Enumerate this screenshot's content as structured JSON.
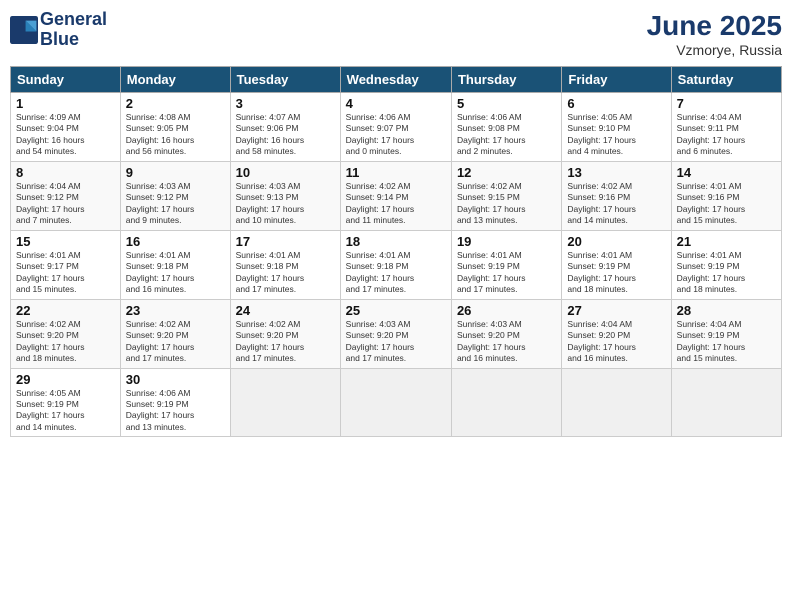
{
  "logo": {
    "line1": "General",
    "line2": "Blue"
  },
  "title": "June 2025",
  "location": "Vzmorye, Russia",
  "days_header": [
    "Sunday",
    "Monday",
    "Tuesday",
    "Wednesday",
    "Thursday",
    "Friday",
    "Saturday"
  ],
  "weeks": [
    [
      {
        "num": "1",
        "info": "Sunrise: 4:09 AM\nSunset: 9:04 PM\nDaylight: 16 hours\nand 54 minutes."
      },
      {
        "num": "2",
        "info": "Sunrise: 4:08 AM\nSunset: 9:05 PM\nDaylight: 16 hours\nand 56 minutes."
      },
      {
        "num": "3",
        "info": "Sunrise: 4:07 AM\nSunset: 9:06 PM\nDaylight: 16 hours\nand 58 minutes."
      },
      {
        "num": "4",
        "info": "Sunrise: 4:06 AM\nSunset: 9:07 PM\nDaylight: 17 hours\nand 0 minutes."
      },
      {
        "num": "5",
        "info": "Sunrise: 4:06 AM\nSunset: 9:08 PM\nDaylight: 17 hours\nand 2 minutes."
      },
      {
        "num": "6",
        "info": "Sunrise: 4:05 AM\nSunset: 9:10 PM\nDaylight: 17 hours\nand 4 minutes."
      },
      {
        "num": "7",
        "info": "Sunrise: 4:04 AM\nSunset: 9:11 PM\nDaylight: 17 hours\nand 6 minutes."
      }
    ],
    [
      {
        "num": "8",
        "info": "Sunrise: 4:04 AM\nSunset: 9:12 PM\nDaylight: 17 hours\nand 7 minutes."
      },
      {
        "num": "9",
        "info": "Sunrise: 4:03 AM\nSunset: 9:12 PM\nDaylight: 17 hours\nand 9 minutes."
      },
      {
        "num": "10",
        "info": "Sunrise: 4:03 AM\nSunset: 9:13 PM\nDaylight: 17 hours\nand 10 minutes."
      },
      {
        "num": "11",
        "info": "Sunrise: 4:02 AM\nSunset: 9:14 PM\nDaylight: 17 hours\nand 11 minutes."
      },
      {
        "num": "12",
        "info": "Sunrise: 4:02 AM\nSunset: 9:15 PM\nDaylight: 17 hours\nand 13 minutes."
      },
      {
        "num": "13",
        "info": "Sunrise: 4:02 AM\nSunset: 9:16 PM\nDaylight: 17 hours\nand 14 minutes."
      },
      {
        "num": "14",
        "info": "Sunrise: 4:01 AM\nSunset: 9:16 PM\nDaylight: 17 hours\nand 15 minutes."
      }
    ],
    [
      {
        "num": "15",
        "info": "Sunrise: 4:01 AM\nSunset: 9:17 PM\nDaylight: 17 hours\nand 15 minutes."
      },
      {
        "num": "16",
        "info": "Sunrise: 4:01 AM\nSunset: 9:18 PM\nDaylight: 17 hours\nand 16 minutes."
      },
      {
        "num": "17",
        "info": "Sunrise: 4:01 AM\nSunset: 9:18 PM\nDaylight: 17 hours\nand 17 minutes."
      },
      {
        "num": "18",
        "info": "Sunrise: 4:01 AM\nSunset: 9:18 PM\nDaylight: 17 hours\nand 17 minutes."
      },
      {
        "num": "19",
        "info": "Sunrise: 4:01 AM\nSunset: 9:19 PM\nDaylight: 17 hours\nand 17 minutes."
      },
      {
        "num": "20",
        "info": "Sunrise: 4:01 AM\nSunset: 9:19 PM\nDaylight: 17 hours\nand 18 minutes."
      },
      {
        "num": "21",
        "info": "Sunrise: 4:01 AM\nSunset: 9:19 PM\nDaylight: 17 hours\nand 18 minutes."
      }
    ],
    [
      {
        "num": "22",
        "info": "Sunrise: 4:02 AM\nSunset: 9:20 PM\nDaylight: 17 hours\nand 18 minutes."
      },
      {
        "num": "23",
        "info": "Sunrise: 4:02 AM\nSunset: 9:20 PM\nDaylight: 17 hours\nand 17 minutes."
      },
      {
        "num": "24",
        "info": "Sunrise: 4:02 AM\nSunset: 9:20 PM\nDaylight: 17 hours\nand 17 minutes."
      },
      {
        "num": "25",
        "info": "Sunrise: 4:03 AM\nSunset: 9:20 PM\nDaylight: 17 hours\nand 17 minutes."
      },
      {
        "num": "26",
        "info": "Sunrise: 4:03 AM\nSunset: 9:20 PM\nDaylight: 17 hours\nand 16 minutes."
      },
      {
        "num": "27",
        "info": "Sunrise: 4:04 AM\nSunset: 9:20 PM\nDaylight: 17 hours\nand 16 minutes."
      },
      {
        "num": "28",
        "info": "Sunrise: 4:04 AM\nSunset: 9:19 PM\nDaylight: 17 hours\nand 15 minutes."
      }
    ],
    [
      {
        "num": "29",
        "info": "Sunrise: 4:05 AM\nSunset: 9:19 PM\nDaylight: 17 hours\nand 14 minutes."
      },
      {
        "num": "30",
        "info": "Sunrise: 4:06 AM\nSunset: 9:19 PM\nDaylight: 17 hours\nand 13 minutes."
      },
      {
        "num": "",
        "info": ""
      },
      {
        "num": "",
        "info": ""
      },
      {
        "num": "",
        "info": ""
      },
      {
        "num": "",
        "info": ""
      },
      {
        "num": "",
        "info": ""
      }
    ]
  ]
}
